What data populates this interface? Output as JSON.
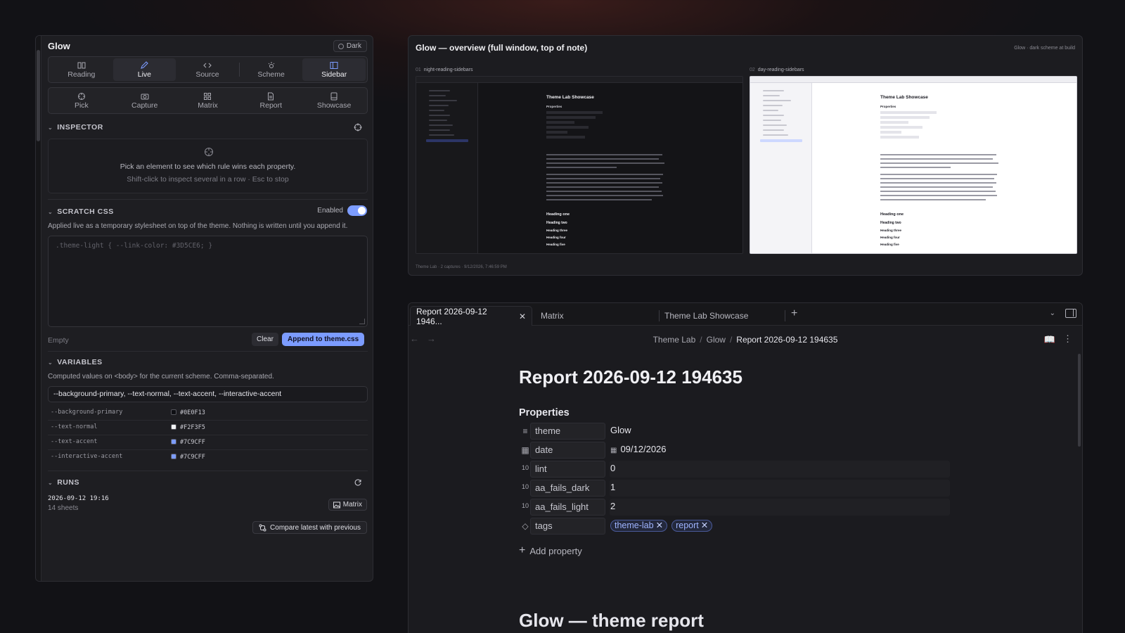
{
  "left_panel": {
    "title": "Glow",
    "scheme_badge": "Dark",
    "view_tabs": [
      {
        "label": "Reading",
        "icon": "book-icon"
      },
      {
        "label": "Live",
        "icon": "pencil-icon"
      },
      {
        "label": "Source",
        "icon": "code-icon"
      },
      {
        "label": "Scheme",
        "icon": "sun-icon"
      },
      {
        "label": "Sidebar",
        "icon": "sidebar-icon"
      }
    ],
    "active_view": "Live",
    "tool_tabs": [
      {
        "label": "Pick",
        "icon": "crosshair-icon"
      },
      {
        "label": "Capture",
        "icon": "camera-icon"
      },
      {
        "label": "Matrix",
        "icon": "grid-icon"
      },
      {
        "label": "Report",
        "icon": "document-icon"
      },
      {
        "label": "Showcase",
        "icon": "display-icon"
      }
    ],
    "inspector": {
      "heading": "INSPECTOR",
      "message": "Pick an element to see which rule wins each property.",
      "hint": "Shift-click to inspect several in a row · Esc to stop"
    },
    "scratch": {
      "heading": "SCRATCH CSS",
      "enabled_label": "Enabled",
      "enabled": true,
      "description": "Applied live as a temporary stylesheet on top of the theme. Nothing is written until you append it.",
      "placeholder": ".theme-light { --link-color: #3D5CE6; }",
      "status": "Empty",
      "clear_label": "Clear",
      "append_label": "Append to theme.css"
    },
    "variables": {
      "heading": "VARIABLES",
      "description": "Computed values on <body> for the current scheme. Comma-separated.",
      "input_value": "--background-primary, --text-normal, --text-accent, --interactive-accent",
      "rows": [
        {
          "name": "--background-primary",
          "value": "#0E0F13",
          "color": "#0E0F13"
        },
        {
          "name": "--text-normal",
          "value": "#F2F3F5",
          "color": "#F2F3F5"
        },
        {
          "name": "--text-accent",
          "value": "#7C9CFF",
          "color": "#7C9CFF"
        },
        {
          "name": "--interactive-accent",
          "value": "#7C9CFF",
          "color": "#7C9CFF"
        }
      ]
    },
    "runs": {
      "heading": "RUNS",
      "date": "2026-09-12  19:16",
      "sheets": "14 sheets",
      "matrix_label": "Matrix",
      "compare_label": "Compare latest with previous"
    }
  },
  "overview": {
    "title": "Glow — overview (full window, top of note)",
    "note": "Glow · dark scheme at build",
    "footer": "Theme Lab · 2 captures · 9/12/2026, 7:46:59 PM",
    "captures": [
      {
        "num": "01",
        "label": "night-reading-sidebars"
      },
      {
        "num": "02",
        "label": "day-reading-sidebars"
      }
    ],
    "thumb_title": "Theme Lab Showcase",
    "thumb_props": "Properties",
    "thumb_headings": [
      "Heading one",
      "Heading two",
      "Heading three",
      "Heading four",
      "Heading five"
    ]
  },
  "note": {
    "tabs": [
      {
        "label": "Report 2026-09-12 1946...",
        "active": true
      },
      {
        "label": "Matrix",
        "active": false
      },
      {
        "label": "Theme Lab Showcase",
        "active": false
      }
    ],
    "breadcrumb": [
      "Theme Lab",
      "Glow",
      "Report 2026-09-12 194635"
    ],
    "title": "Report 2026-09-12 194635",
    "properties_heading": "Properties",
    "properties": [
      {
        "key": "theme",
        "value": "Glow",
        "icon": "list-icon"
      },
      {
        "key": "date",
        "value": "09/12/2026",
        "icon": "calendar-icon"
      },
      {
        "key": "lint",
        "value": "0",
        "icon": "number-icon"
      },
      {
        "key": "aa_fails_dark",
        "value": "1",
        "icon": "number-icon"
      },
      {
        "key": "aa_fails_light",
        "value": "2",
        "icon": "number-icon"
      },
      {
        "key": "tags",
        "icon": "tags-icon"
      }
    ],
    "tags": [
      "theme-lab",
      "report"
    ],
    "add_property": "Add property",
    "next_heading": "Glow — theme report"
  },
  "colors": {
    "accent": "#7C9CFF",
    "background": "#121216"
  }
}
